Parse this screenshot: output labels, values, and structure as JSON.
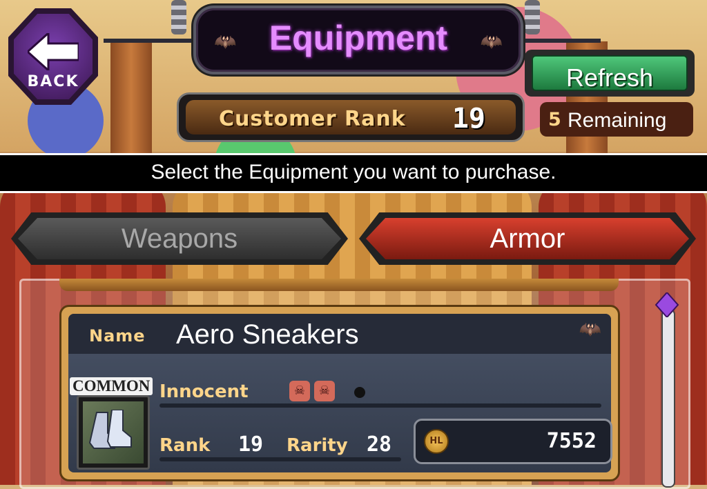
{
  "screen": {
    "title": "Equipment",
    "back_label": "BACK",
    "refresh_label": "Refresh",
    "customer_rank_label": "Customer Rank",
    "customer_rank_value": "19",
    "remaining_count": "5",
    "remaining_label": "Remaining",
    "instruction": "Select the Equipment you want to purchase."
  },
  "tabs": [
    {
      "label": "Weapons",
      "active": false
    },
    {
      "label": "Armor",
      "active": true
    }
  ],
  "item": {
    "name_label": "Name",
    "name": "Aero Sneakers",
    "rarity_tag": "COMMON",
    "class": "Innocent",
    "rank_label": "Rank",
    "rank": "19",
    "rarity_label": "Rarity",
    "rarity": "28",
    "currency_icon": "HL",
    "price": "7552"
  },
  "colors": {
    "title": "#e58cff",
    "refresh": "#2e9e55",
    "armor_tab": "#c0321f",
    "gold_label": "#ffd58a"
  }
}
